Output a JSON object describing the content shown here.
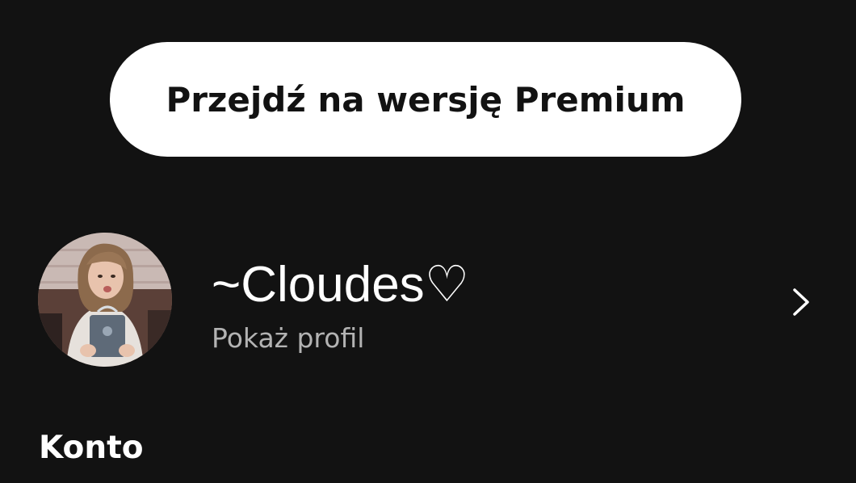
{
  "premium_button": {
    "label": "Przejdź na wersję Premium"
  },
  "profile": {
    "name": "~Cloudes♡",
    "subtitle": "Pokaż profil",
    "avatar_icon": "user-avatar-photo",
    "chevron_icon": "chevron-right-icon"
  },
  "section": {
    "title": "Konto"
  },
  "colors": {
    "background": "#121212",
    "button_bg": "#ffffff",
    "button_text": "#121212",
    "primary_text": "#ffffff",
    "secondary_text": "#b3b3b3"
  }
}
